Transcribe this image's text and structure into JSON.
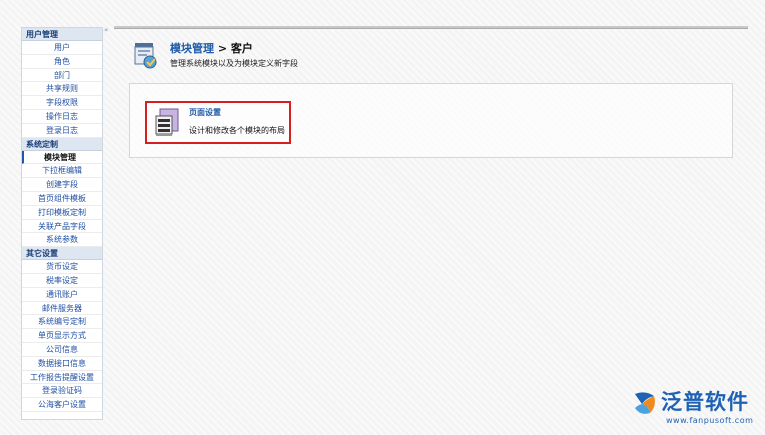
{
  "sidebar": {
    "collapse_glyph": "«",
    "sections": [
      {
        "title": "用户管理",
        "items": [
          {
            "label": "用户"
          },
          {
            "label": "角色"
          },
          {
            "label": "部门"
          },
          {
            "label": "共享规则"
          },
          {
            "label": "字段权限"
          },
          {
            "label": "操作日志"
          },
          {
            "label": "登录日志"
          }
        ]
      },
      {
        "title": "系统定制",
        "items": [
          {
            "label": "模块管理",
            "active": true
          },
          {
            "label": "下拉框编辑"
          },
          {
            "label": "创建字段"
          },
          {
            "label": "首页组件模板"
          },
          {
            "label": "打印模板定制"
          },
          {
            "label": "关联产品字段"
          },
          {
            "label": "系统参数"
          }
        ]
      },
      {
        "title": "其它设置",
        "items": [
          {
            "label": "货币设定"
          },
          {
            "label": "税率设定"
          },
          {
            "label": "通讯账户"
          },
          {
            "label": "邮件服务器"
          },
          {
            "label": "系统编号定制"
          },
          {
            "label": "单页显示方式"
          },
          {
            "label": "公司信息"
          },
          {
            "label": "数据接口信息"
          },
          {
            "label": "工作报告提醒设置"
          },
          {
            "label": "登录验证码"
          },
          {
            "label": "公海客户设置"
          }
        ]
      }
    ]
  },
  "header": {
    "title_link": "模块管理",
    "title_rest": " > 客户",
    "description": "管理系统模块以及为模块定义新字段"
  },
  "setting_card": {
    "title": "页面设置",
    "description": "设计和修改各个模块的布局"
  },
  "watermark": {
    "brand_name": "泛普软件",
    "url": "www.fanpusoft.com"
  },
  "colors": {
    "link_blue": "#1e5aa8",
    "highlight_red": "#d42020",
    "brand_blue": "#1e61b5"
  },
  "icons": {
    "header": "module-manager-icon",
    "card": "page-layout-icon",
    "brand": "fanpu-logo-icon"
  }
}
